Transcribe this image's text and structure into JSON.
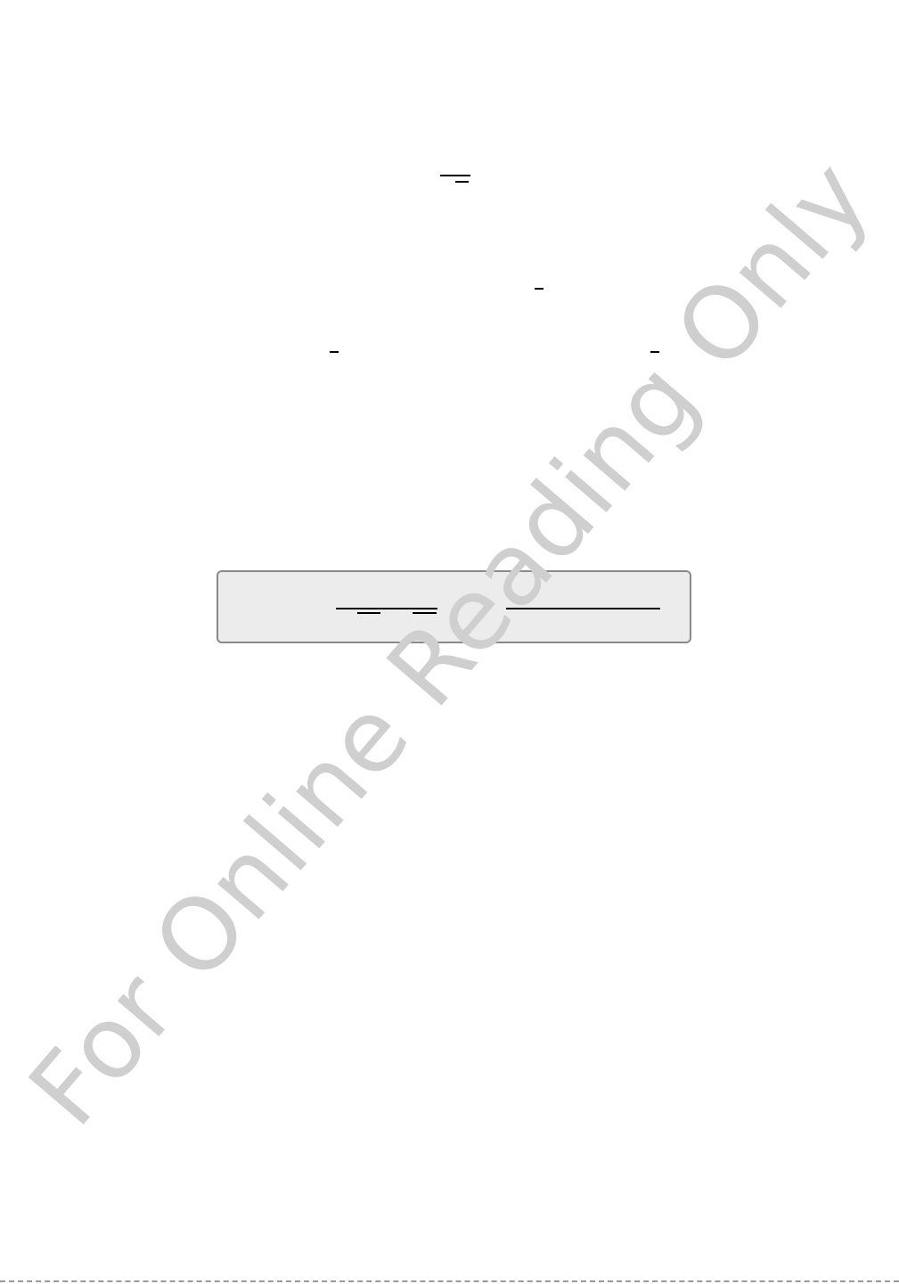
{
  "watermark": {
    "text": "For Online Reading Only",
    "color": "#cfcfcf"
  },
  "formula_box": {
    "background": "#ececec",
    "border_color": "#8a8a8a"
  }
}
